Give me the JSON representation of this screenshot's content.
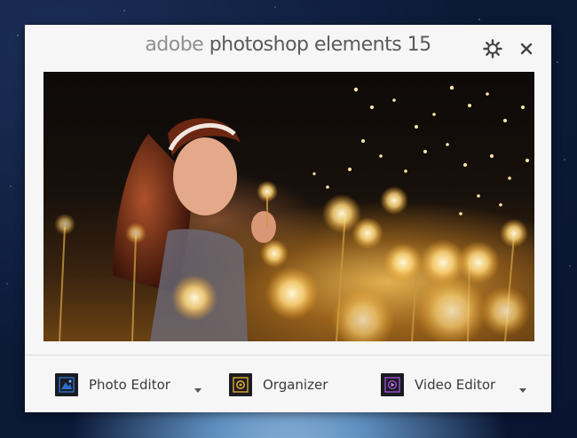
{
  "window": {
    "title_word_1": "adobe",
    "title_word_2": "photoshop elements 15",
    "icons": {
      "settings": "gear-icon",
      "close": "close-icon"
    }
  },
  "hero": {
    "description_icon": "hero-photo"
  },
  "launchers": [
    {
      "label": "Photo Editor",
      "icon": "photo-editor-icon",
      "has_dropdown": true,
      "accent": "#2d6fcf"
    },
    {
      "label": "Organizer",
      "icon": "organizer-icon",
      "has_dropdown": false,
      "accent": "#e0a82a"
    },
    {
      "label": "Video Editor",
      "icon": "video-editor-icon",
      "has_dropdown": true,
      "accent": "#9a4fcf"
    }
  ],
  "colors": {
    "window_bg": "#f6f6f6",
    "title_text": "#5b5b5b",
    "label_text": "#3a3a3a",
    "tile_bg": "#1b1b22"
  }
}
